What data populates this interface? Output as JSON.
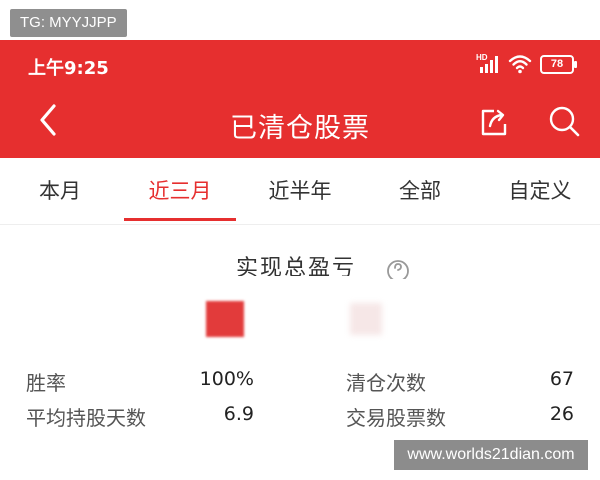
{
  "overlay": {
    "tg_label": "TG: MYYJJPP",
    "watermark": "www.worlds21dian.com"
  },
  "status_bar": {
    "time": "上午9:25",
    "battery": "78",
    "hd": "HD"
  },
  "header": {
    "title": "已清仓股票"
  },
  "tabs": [
    {
      "label": "本月",
      "active": false
    },
    {
      "label": "近三月",
      "active": true
    },
    {
      "label": "近半年",
      "active": false
    },
    {
      "label": "全部",
      "active": false
    },
    {
      "label": "自定义",
      "active": false
    }
  ],
  "summary": {
    "title": "实现总盈亏"
  },
  "stats": {
    "win_rate": {
      "label": "胜率",
      "value": "100%"
    },
    "avg_hold_days": {
      "label": "平均持股天数",
      "value": "6.9"
    },
    "close_count": {
      "label": "清仓次数",
      "value": "67"
    },
    "traded_stocks": {
      "label": "交易股票数",
      "value": "26"
    }
  },
  "colors": {
    "brand_red": "#e62f2f",
    "text_dark": "#222222",
    "text_gray": "#555555"
  },
  "icons": [
    "back-arrow-icon",
    "share-icon",
    "search-icon",
    "help-icon",
    "signal-icon",
    "wifi-icon",
    "battery-icon"
  ]
}
